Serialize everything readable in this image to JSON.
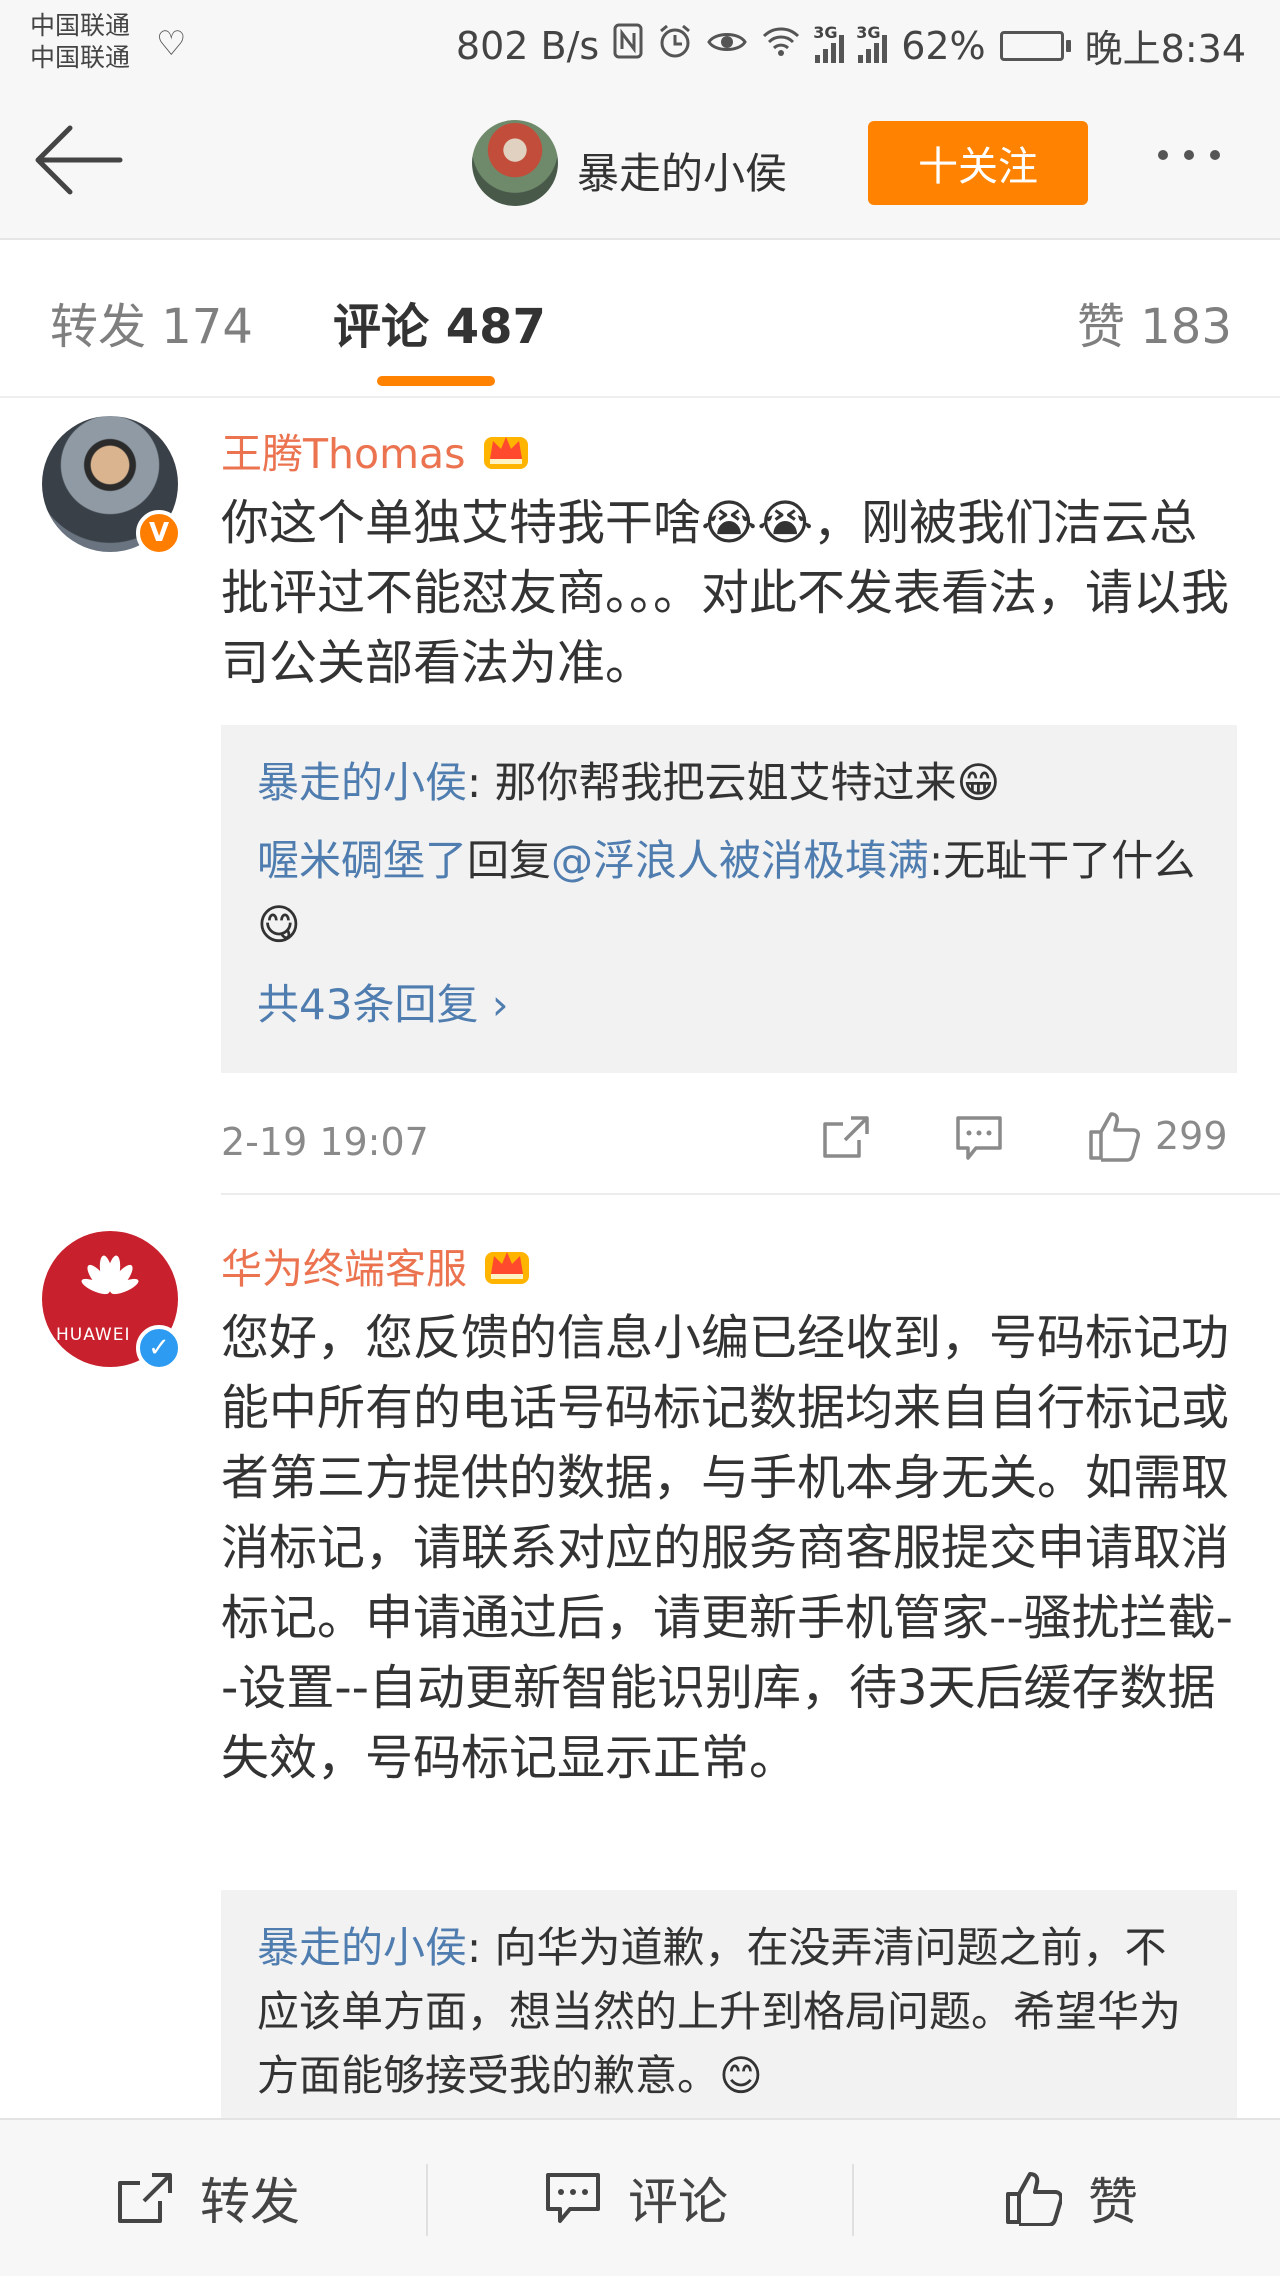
{
  "status_bar": {
    "carrier1": "中国联通",
    "carrier2": "中国联通",
    "net_speed": "802 B/s",
    "network_type": "3G",
    "battery": "62%",
    "battery_level": 0.62,
    "time": "晚上8:34",
    "icons": [
      "heart-rate-icon",
      "nfc-icon",
      "alarm-icon",
      "eye-icon",
      "wifi-icon",
      "signal-icon",
      "battery-icon"
    ]
  },
  "header": {
    "user_name": "暴走的小侯",
    "follow_label": "十关注"
  },
  "tabs": [
    {
      "label": "转发 174"
    },
    {
      "label": "评论 487"
    },
    {
      "label": "赞 183"
    }
  ],
  "comments": [
    {
      "author": "王腾Thomas",
      "text": "你这个单独艾特我干啥😭😭，刚被我们洁云总批评过不能怼友商。。。对此不发表看法，请以我司公关部看法为准。",
      "replies": [
        {
          "user": "暴走的小侯",
          "sep": ": ",
          "text": "那你帮我把云姐艾特过来😁"
        },
        {
          "user": "喔米碉堡了",
          "mid": "回复",
          "target": "@浮浪人被消极填满",
          "sep": ":",
          "text": "无耻干了什么😋"
        }
      ],
      "more_replies": "共43条回复 ›",
      "time": "2-19 19:07",
      "likes": "299"
    },
    {
      "author": "华为终端客服",
      "avatar_text": "HUAWEI",
      "text": "您好，您反馈的信息小编已经收到，号码标记功能中所有的电话号码标记数据均来自自行标记或者第三方提供的数据，与手机本身无关。如需取消标记，请联系对应的服务商客服提交申请取消标记。申请通过后，请更新手机管家--骚扰拦截--设置--自动更新智能识别库，待3天后缓存数据失效，号码标记显示正常。",
      "replies": [
        {
          "user": "暴走的小侯",
          "sep": ": ",
          "text": "向华为道歉，在没弄清问题之前，不应该单方面，想当然的上升到格局问题。希望华为方面能够接受我的歉意。😊"
        }
      ]
    }
  ],
  "bottom_bar": {
    "repost": "转发",
    "comment": "评论",
    "like": "赞"
  },
  "colors": {
    "accent": "#ff8200",
    "author_name": "#eb7350",
    "link": "#507daf",
    "verified_orange": "#ff7e00",
    "verified_blue": "#2c9bf1",
    "huawei_red": "#c8202c"
  }
}
